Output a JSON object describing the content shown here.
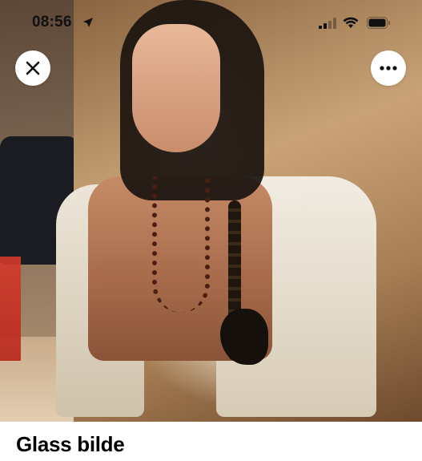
{
  "status_bar": {
    "time": "08:56",
    "icons": [
      "location-arrow-icon",
      "signal-icon",
      "wifi-icon",
      "battery-icon"
    ]
  },
  "photo": {
    "description_icon": "photo-preview"
  },
  "toolbar": {
    "close_icon": "close-icon",
    "more_icon": "more-icon"
  },
  "listing": {
    "title": "Glass bilde"
  }
}
